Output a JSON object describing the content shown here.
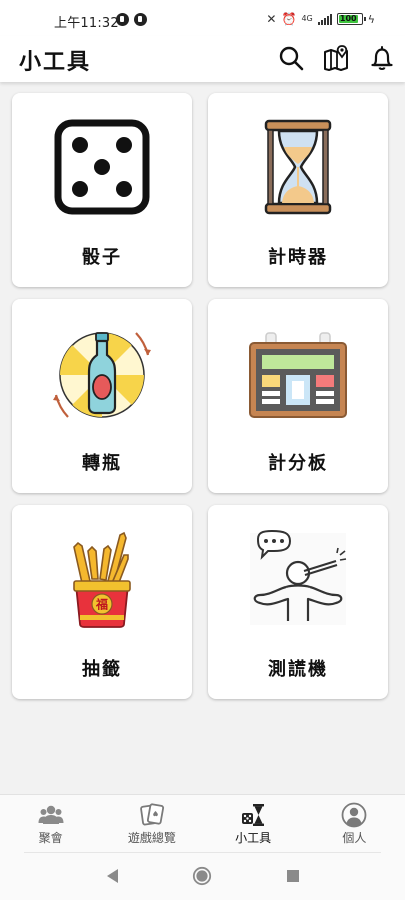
{
  "status_bar": {
    "time": "上午11:32",
    "network_label": "4G",
    "battery_level": "100"
  },
  "app_bar": {
    "title": "小工具",
    "actions": [
      {
        "name": "search",
        "icon": "search-icon"
      },
      {
        "name": "map",
        "icon": "map-location-icon"
      },
      {
        "name": "notifications",
        "icon": "bell-icon"
      }
    ]
  },
  "tools": [
    {
      "label": "骰子",
      "icon": "dice-icon"
    },
    {
      "label": "計時器",
      "icon": "hourglass-icon"
    },
    {
      "label": "轉瓶",
      "icon": "spin-bottle-icon"
    },
    {
      "label": "計分板",
      "icon": "scoreboard-icon"
    },
    {
      "label": "抽籤",
      "icon": "fortune-sticks-icon"
    },
    {
      "label": "測謊機",
      "icon": "lie-detector-icon"
    }
  ],
  "fortune_cup_char": "福",
  "bottom_nav": {
    "items": [
      {
        "label": "聚會",
        "icon": "people-icon",
        "active": false
      },
      {
        "label": "遊戲總覽",
        "icon": "cards-icon",
        "active": false
      },
      {
        "label": "小工具",
        "icon": "tools-dice-hourglass-icon",
        "active": true
      },
      {
        "label": "個人",
        "icon": "person-icon",
        "active": false
      }
    ]
  },
  "colors": {
    "background": "#f2f2f2",
    "surface": "#ffffff",
    "text": "#111111",
    "nav_inactive": "#555555",
    "battery_green": "#3ec43e"
  }
}
